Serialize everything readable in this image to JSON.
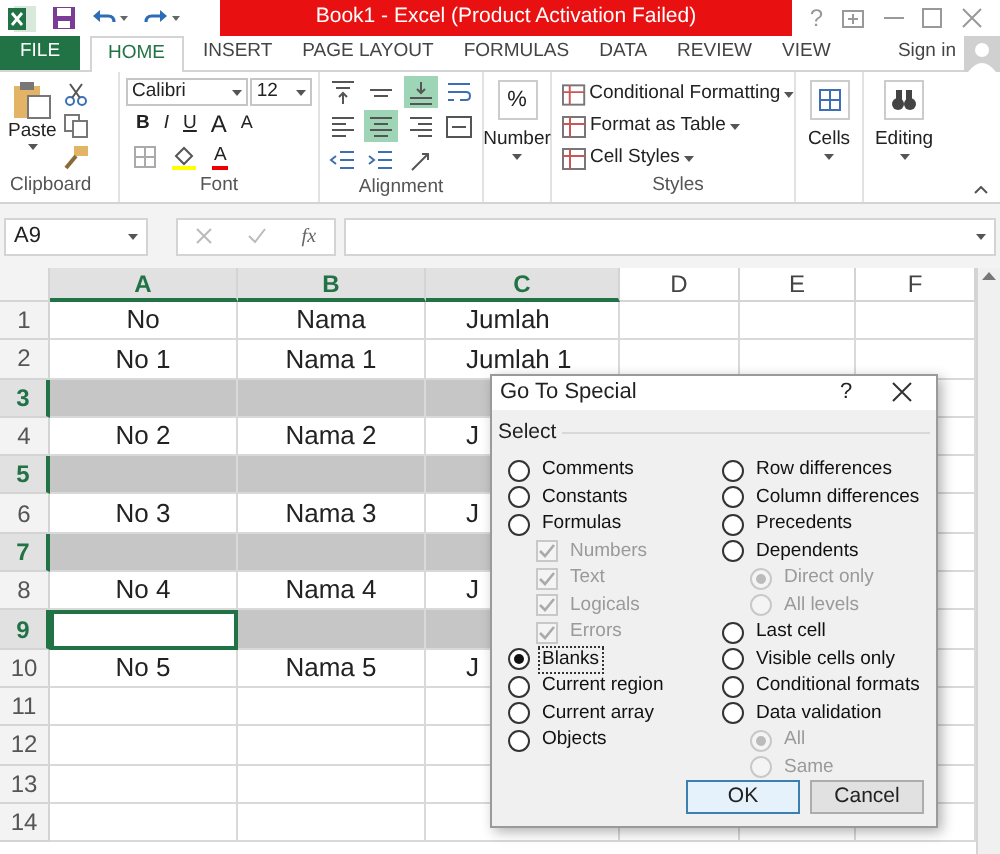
{
  "title_bar": {
    "title": "Book1 -  Excel (Product Activation Failed)",
    "help": "?"
  },
  "ribbon_tabs": [
    {
      "label": "FILE",
      "kind": "file",
      "selected": false
    },
    {
      "label": "HOME",
      "kind": "tab",
      "selected": true
    },
    {
      "label": "INSERT",
      "kind": "tab",
      "selected": false
    },
    {
      "label": "PAGE LAYOUT",
      "kind": "tab",
      "selected": false
    },
    {
      "label": "FORMULAS",
      "kind": "tab",
      "selected": false
    },
    {
      "label": "DATA",
      "kind": "tab",
      "selected": false
    },
    {
      "label": "REVIEW",
      "kind": "tab",
      "selected": false
    },
    {
      "label": "VIEW",
      "kind": "tab",
      "selected": false
    }
  ],
  "sign_in": "Sign in",
  "ribbon": {
    "clipboard": {
      "paste": "Paste",
      "label": "Clipboard"
    },
    "font": {
      "name": "Calibri",
      "size": "12",
      "bold": "B",
      "italic": "I",
      "underline": "U",
      "grow": "A",
      "shrink": "A",
      "color_letter": "A",
      "label": "Font"
    },
    "alignment": {
      "label": "Alignment",
      "buttons": [
        {
          "kind": "top",
          "selected": false
        },
        {
          "kind": "middle",
          "selected": false
        },
        {
          "kind": "bottom",
          "selected": true
        },
        {
          "kind": "wrap",
          "selected": false
        },
        {
          "kind": "left",
          "selected": false
        },
        {
          "kind": "center",
          "selected": true
        },
        {
          "kind": "right",
          "selected": false
        },
        {
          "kind": "merge",
          "selected": false
        },
        {
          "kind": "outdent",
          "selected": false
        },
        {
          "kind": "indent",
          "selected": false
        },
        {
          "kind": "orientation",
          "selected": false
        }
      ]
    },
    "number": {
      "symbol": "%",
      "label": "Number"
    },
    "styles": {
      "items": [
        "Conditional Formatting",
        "Format as Table",
        "Cell Styles"
      ],
      "label": "Styles"
    },
    "cells": {
      "label": "Cells"
    },
    "editing": {
      "label": "Editing"
    }
  },
  "formula_bar": {
    "name_box": "A9",
    "function_label": "fx"
  },
  "sheet": {
    "columns": [
      {
        "label": "A",
        "selected": true
      },
      {
        "label": "B",
        "selected": true
      },
      {
        "label": "C",
        "selected": true
      },
      {
        "label": "D",
        "selected": false
      },
      {
        "label": "E",
        "selected": false
      },
      {
        "label": "F",
        "selected": false
      }
    ],
    "rows": [
      {
        "number": "1",
        "selected": false,
        "active": false,
        "cells": [
          "No",
          "Nama",
          "Jumlah"
        ]
      },
      {
        "number": "2",
        "selected": false,
        "active": false,
        "cells": [
          "No 1",
          "Nama 1",
          "Jumlah 1"
        ]
      },
      {
        "number": "3",
        "selected": true,
        "active": false,
        "cells": []
      },
      {
        "number": "4",
        "selected": false,
        "active": false,
        "cells": [
          "No 2",
          "Nama 2",
          "J"
        ]
      },
      {
        "number": "5",
        "selected": true,
        "active": false,
        "cells": []
      },
      {
        "number": "6",
        "selected": false,
        "active": false,
        "cells": [
          "No 3",
          "Nama 3",
          "J"
        ]
      },
      {
        "number": "7",
        "selected": true,
        "active": false,
        "cells": []
      },
      {
        "number": "8",
        "selected": false,
        "active": false,
        "cells": [
          "No 4",
          "Nama 4",
          "J"
        ]
      },
      {
        "number": "9",
        "selected": true,
        "active": true,
        "cells": []
      },
      {
        "number": "10",
        "selected": false,
        "active": false,
        "cells": [
          "No 5",
          "Nama 5",
          "J"
        ]
      },
      {
        "number": "11",
        "selected": false,
        "active": false,
        "cells": []
      },
      {
        "number": "12",
        "selected": false,
        "active": false,
        "cells": []
      },
      {
        "number": "13",
        "selected": false,
        "active": false,
        "cells": []
      },
      {
        "number": "14",
        "selected": false,
        "active": false,
        "cells": []
      }
    ]
  },
  "dialog": {
    "title": "Go To Special",
    "help": "?",
    "group_label": "Select",
    "left": [
      {
        "label": "Comments",
        "selected": false
      },
      {
        "label": "Constants",
        "selected": false
      },
      {
        "label": "Formulas",
        "selected": false,
        "children": [
          {
            "label": "Numbers",
            "checked": true,
            "disabled": true
          },
          {
            "label": "Text",
            "checked": true,
            "disabled": true
          },
          {
            "label": "Logicals",
            "checked": true,
            "disabled": true
          },
          {
            "label": "Errors",
            "checked": true,
            "disabled": true
          }
        ]
      },
      {
        "label": "Blanks",
        "selected": true
      },
      {
        "label": "Current region",
        "selected": false
      },
      {
        "label": "Current array",
        "selected": false
      },
      {
        "label": "Objects",
        "selected": false
      }
    ],
    "right": [
      {
        "label": "Row differences",
        "selected": false
      },
      {
        "label": "Column differences",
        "selected": false
      },
      {
        "label": "Precedents",
        "selected": false
      },
      {
        "label": "Dependents",
        "selected": false,
        "children": [
          {
            "label": "Direct only",
            "selected": true,
            "disabled": true
          },
          {
            "label": "All levels",
            "selected": false,
            "disabled": true
          }
        ]
      },
      {
        "label": "Last cell",
        "selected": false
      },
      {
        "label": "Visible cells only",
        "selected": false
      },
      {
        "label": "Conditional formats",
        "selected": false
      },
      {
        "label": "Data validation",
        "selected": false,
        "children": [
          {
            "label": "All",
            "selected": true,
            "disabled": true
          },
          {
            "label": "Same",
            "selected": false,
            "disabled": true
          }
        ]
      }
    ],
    "buttons": [
      {
        "label": "OK",
        "kind": "default"
      },
      {
        "label": "Cancel",
        "kind": "normal"
      }
    ]
  }
}
